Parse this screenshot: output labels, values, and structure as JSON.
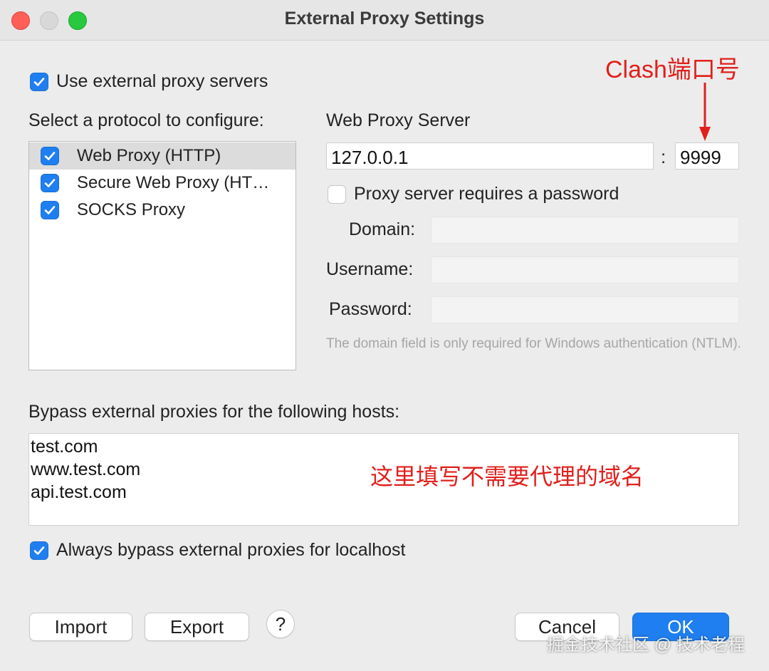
{
  "window": {
    "title": "External Proxy Settings"
  },
  "use_external": {
    "label": "Use external proxy servers",
    "checked": true
  },
  "protocols": {
    "heading": "Select a protocol to configure:",
    "items": [
      {
        "label": "Web Proxy (HTTP)",
        "checked": true,
        "selected": true
      },
      {
        "label": "Secure Web Proxy (HT…",
        "checked": true,
        "selected": false
      },
      {
        "label": "SOCKS Proxy",
        "checked": true,
        "selected": false
      }
    ]
  },
  "server": {
    "heading": "Web Proxy Server",
    "host": "127.0.0.1",
    "separator": ":",
    "port": "9999",
    "requires_password_label": "Proxy server requires a password",
    "requires_password_checked": false,
    "domain_label": "Domain:",
    "username_label": "Username:",
    "password_label": "Password:",
    "note": "The domain field is only required for Windows authentication (NTLM)."
  },
  "bypass": {
    "heading": "Bypass external proxies for the following hosts:",
    "hosts": [
      "test.com",
      "www.test.com",
      "api.test.com"
    ],
    "localhost_label": "Always bypass external proxies for localhost",
    "localhost_checked": true
  },
  "buttons": {
    "import": "Import",
    "export": "Export",
    "help": "?",
    "cancel": "Cancel",
    "ok": "OK"
  },
  "annotations": {
    "port": "Clash端口号",
    "bypass": "这里填写不需要代理的域名",
    "color": "#e0201c"
  },
  "watermark": "掘金技术社区 @ 技术老程"
}
